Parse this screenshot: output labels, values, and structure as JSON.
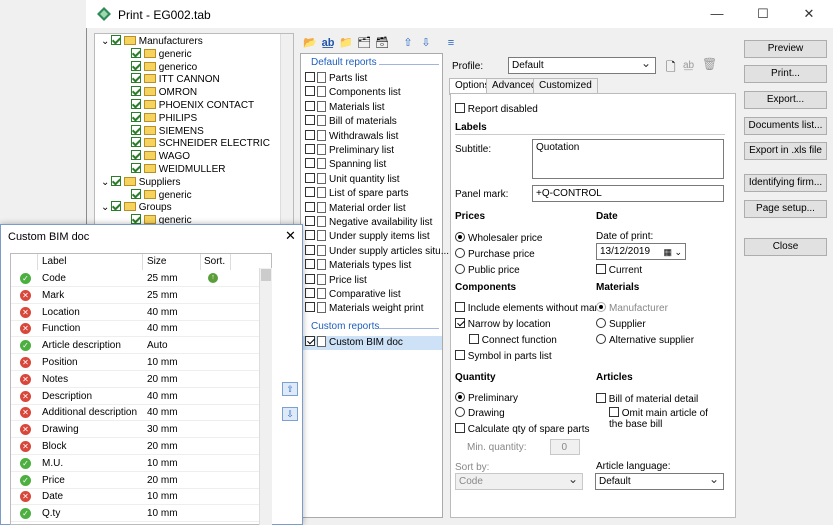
{
  "window": {
    "title": "Print - EG002.tab",
    "minimize": "—",
    "maximize": "☐",
    "close": "✕"
  },
  "tree": {
    "items": [
      {
        "label": "Manufacturers",
        "level": 1
      },
      {
        "label": "generic",
        "level": 2
      },
      {
        "label": "generico",
        "level": 2
      },
      {
        "label": "ITT CANNON",
        "level": 2
      },
      {
        "label": "OMRON",
        "level": 2
      },
      {
        "label": "PHOENIX CONTACT",
        "level": 2
      },
      {
        "label": "PHILIPS",
        "level": 2
      },
      {
        "label": "SIEMENS",
        "level": 2
      },
      {
        "label": "SCHNEIDER ELECTRIC",
        "level": 2
      },
      {
        "label": "WAGO",
        "level": 2
      },
      {
        "label": "WEIDMULLER",
        "level": 2
      },
      {
        "label": "Suppliers",
        "level": 1
      },
      {
        "label": "generic",
        "level": 2
      },
      {
        "label": "Groups",
        "level": 1
      },
      {
        "label": "generic",
        "level": 2
      }
    ]
  },
  "reports": {
    "default_header": "Default reports",
    "default_items": [
      "Parts list",
      "Components list",
      "Materials list",
      "Bill of materials",
      "Withdrawals list",
      "Preliminary list",
      "Spanning list",
      "Unit quantity list",
      "List of spare parts",
      "Material order list",
      "Negative availability list",
      "Under supply items list",
      "Under supply articles situ...",
      "Materials types list",
      "Price list",
      "Comparative list",
      "Materials weight print"
    ],
    "custom_header": "Custom reports",
    "custom_items": [
      "Custom BIM doc"
    ]
  },
  "profile": {
    "label": "Profile:",
    "value": "Default"
  },
  "tabs": [
    "Options",
    "Advanced",
    "Customized"
  ],
  "options": {
    "report_disabled": "Report disabled",
    "labels_header": "Labels",
    "subtitle_label": "Subtitle:",
    "subtitle_value": "Quotation",
    "panel_mark_label": "Panel mark:",
    "panel_mark_value": "+Q-CONTROL",
    "prices_header": "Prices",
    "prices": [
      "Wholesaler price",
      "Purchase price",
      "Public price"
    ],
    "date_header": "Date",
    "date_of_print_label": "Date of print:",
    "date_value": "13/12/2019",
    "current_label": "Current",
    "components_header": "Components",
    "components": [
      "Include elements without mark",
      "Narrow by location",
      "Connect function",
      "Symbol in parts list"
    ],
    "materials_header": "Materials",
    "materials": [
      "Manufacturer",
      "Supplier",
      "Alternative supplier"
    ],
    "quantity_header": "Quantity",
    "quantity": [
      "Preliminary",
      "Drawing"
    ],
    "calc_spare": "Calculate qty of spare parts",
    "min_qty_label": "Min. quantity:",
    "min_qty_value": "0",
    "sort_by_label": "Sort by:",
    "sort_by_value": "Code",
    "articles_header": "Articles",
    "bom_detail": "Bill of material detail",
    "omit_main": "Omit main article of the base bill",
    "article_lang_label": "Article language:",
    "article_lang_value": "Default"
  },
  "buttons": [
    "Preview",
    "Print...",
    "Export...",
    "Documents list...",
    "Export in .xls file",
    "Identifying firm...",
    "Page setup...",
    "Close"
  ],
  "bim": {
    "title": "Custom BIM doc",
    "columns": [
      "Label",
      "Size",
      "Sort."
    ],
    "rows": [
      {
        "label": "Code",
        "size": "25 mm",
        "on": true,
        "sort": true
      },
      {
        "label": "Mark",
        "size": "25 mm",
        "on": false
      },
      {
        "label": "Location",
        "size": "40 mm",
        "on": false
      },
      {
        "label": "Function",
        "size": "40 mm",
        "on": false
      },
      {
        "label": "Article description",
        "size": "Auto",
        "on": true
      },
      {
        "label": "Position",
        "size": "10 mm",
        "on": false
      },
      {
        "label": "Notes",
        "size": "20 mm",
        "on": false
      },
      {
        "label": "Description",
        "size": "40 mm",
        "on": false
      },
      {
        "label": "Additional description",
        "size": "40 mm",
        "on": false
      },
      {
        "label": "Drawing",
        "size": "30 mm",
        "on": false
      },
      {
        "label": "Block",
        "size": "20 mm",
        "on": false
      },
      {
        "label": "M.U.",
        "size": "10 mm",
        "on": true
      },
      {
        "label": "Price",
        "size": "20 mm",
        "on": true
      },
      {
        "label": "Date",
        "size": "10 mm",
        "on": false
      },
      {
        "label": "Q.ty",
        "size": "10 mm",
        "on": true
      }
    ]
  }
}
